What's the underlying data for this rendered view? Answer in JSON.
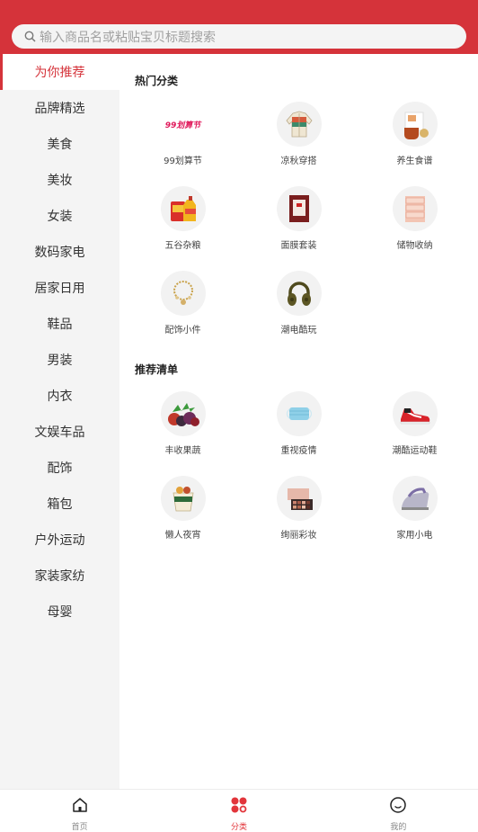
{
  "search": {
    "placeholder": "输入商品名或粘贴宝贝标题搜索"
  },
  "sidebar": {
    "items": [
      "为你推荐",
      "品牌精选",
      "美食",
      "美妆",
      "女装",
      "数码家电",
      "居家日用",
      "鞋品",
      "男装",
      "内衣",
      "文娱车品",
      "配饰",
      "箱包",
      "户外运动",
      "家装家纺",
      "母婴"
    ]
  },
  "hot": {
    "title": "热门分类",
    "items": [
      {
        "label": "99划算节",
        "icon": "99-festival-logo",
        "logo_text": "99划算节"
      },
      {
        "label": "凉秋穿搭",
        "icon": "jacket-icon"
      },
      {
        "label": "养生食谱",
        "icon": "health-tea-icon"
      },
      {
        "label": "五谷杂粮",
        "icon": "oil-rice-icon"
      },
      {
        "label": "面膜套装",
        "icon": "face-mask-icon"
      },
      {
        "label": "储物收纳",
        "icon": "storage-drawer-icon"
      },
      {
        "label": "配饰小件",
        "icon": "bracelet-icon"
      },
      {
        "label": "潮电酷玩",
        "icon": "headphones-icon"
      }
    ]
  },
  "recommend": {
    "title": "推荐清单",
    "items": [
      {
        "label": "丰收果蔬",
        "icon": "fruits-icon"
      },
      {
        "label": "重视疫情",
        "icon": "medical-mask-icon"
      },
      {
        "label": "潮酷运动鞋",
        "icon": "sneaker-icon"
      },
      {
        "label": "懒人夜宵",
        "icon": "snack-box-icon"
      },
      {
        "label": "绚丽彩妆",
        "icon": "eyeshadow-palette-icon"
      },
      {
        "label": "家用小电",
        "icon": "iron-icon"
      }
    ]
  },
  "tabbar": {
    "items": [
      {
        "label": "首页",
        "icon": "home-icon"
      },
      {
        "label": "分类",
        "icon": "category-icon"
      },
      {
        "label": "我的",
        "icon": "profile-icon"
      }
    ],
    "active_color": "#e2353b"
  },
  "colors": {
    "brand": "#d5333a"
  }
}
